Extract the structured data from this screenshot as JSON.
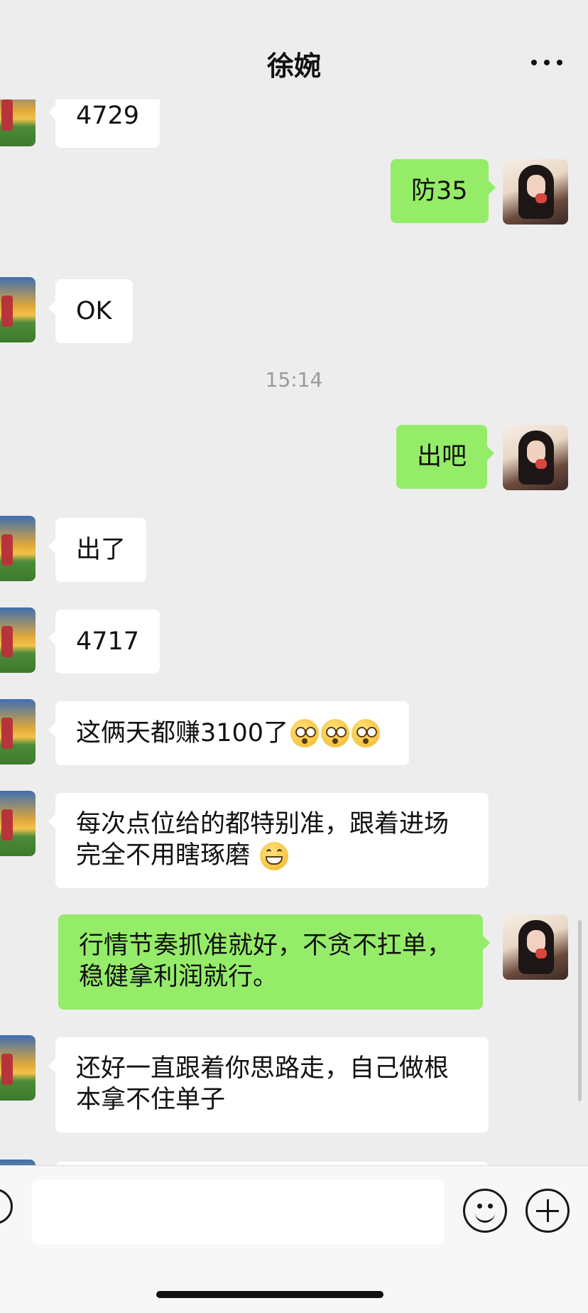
{
  "header": {
    "title": "徐婉",
    "more_icon": "more-icon"
  },
  "timestamp": "15:14",
  "messages": [
    {
      "side": "left",
      "text": "4729"
    },
    {
      "side": "right",
      "text": "防35"
    },
    {
      "side": "left",
      "text": "OK"
    },
    {
      "side": "right",
      "text": "出吧"
    },
    {
      "side": "left",
      "text": "出了"
    },
    {
      "side": "left",
      "text": "4717"
    },
    {
      "side": "left",
      "text": "这俩天都赚3100了",
      "emoji": "flushed-face x3"
    },
    {
      "side": "left",
      "text_line1": "每次点位给的都特别准，跟着进场",
      "text_line2": "完全不用瞎琢磨",
      "emoji": "grinning-face"
    },
    {
      "side": "right",
      "text_line1": "行情节奏抓准就好，不贪不扛单，",
      "text_line2": "稳健拿利润就行。"
    },
    {
      "side": "left",
      "text_line1": "还好一直跟着你思路走，自己做根",
      "text_line2": "本拿不住单子"
    }
  ],
  "input_bar": {
    "placeholder": ""
  },
  "colors": {
    "background": "#ededed",
    "sent_bubble": "#95ec69",
    "received_bubble": "#ffffff"
  }
}
